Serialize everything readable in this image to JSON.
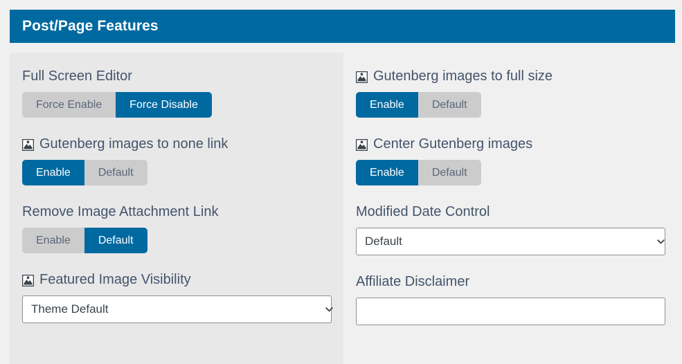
{
  "header": {
    "title": "Post/Page Features",
    "bg_color": "#0069a0"
  },
  "theme": {
    "accent": "#0069a0",
    "inactive_button_bg": "#cccccc",
    "left_column_bg": "#e8e8e8",
    "right_column_bg": "#f0f0f0",
    "label_color": "#44546b"
  },
  "left_column": {
    "fields": [
      {
        "label": "Full Screen Editor",
        "icon": null,
        "control": "button-group",
        "options": [
          "Force Enable",
          "Force Disable"
        ],
        "selected": "Force Disable"
      },
      {
        "label": "Gutenberg images to none link",
        "icon": "broken-image-icon",
        "control": "button-group",
        "options": [
          "Enable",
          "Default"
        ],
        "selected": "Enable"
      },
      {
        "label": "Remove Image Attachment Link",
        "icon": null,
        "control": "button-group",
        "options": [
          "Enable",
          "Default"
        ],
        "selected": "Default"
      },
      {
        "label": "Featured Image Visibility",
        "icon": "broken-image-icon",
        "control": "select",
        "value": "Theme Default"
      }
    ]
  },
  "right_column": {
    "fields": [
      {
        "label": "Gutenberg images to full size",
        "icon": "broken-image-icon",
        "control": "button-group",
        "options": [
          "Enable",
          "Default"
        ],
        "selected": "Enable"
      },
      {
        "label": "Center Gutenberg images",
        "icon": "broken-image-icon",
        "control": "button-group",
        "options": [
          "Enable",
          "Default"
        ],
        "selected": "Enable"
      },
      {
        "label": "Modified Date Control",
        "icon": null,
        "control": "select",
        "value": "Default"
      },
      {
        "label": "Affiliate Disclaimer",
        "icon": null,
        "control": "text-input",
        "value": "",
        "placeholder": ""
      }
    ]
  }
}
